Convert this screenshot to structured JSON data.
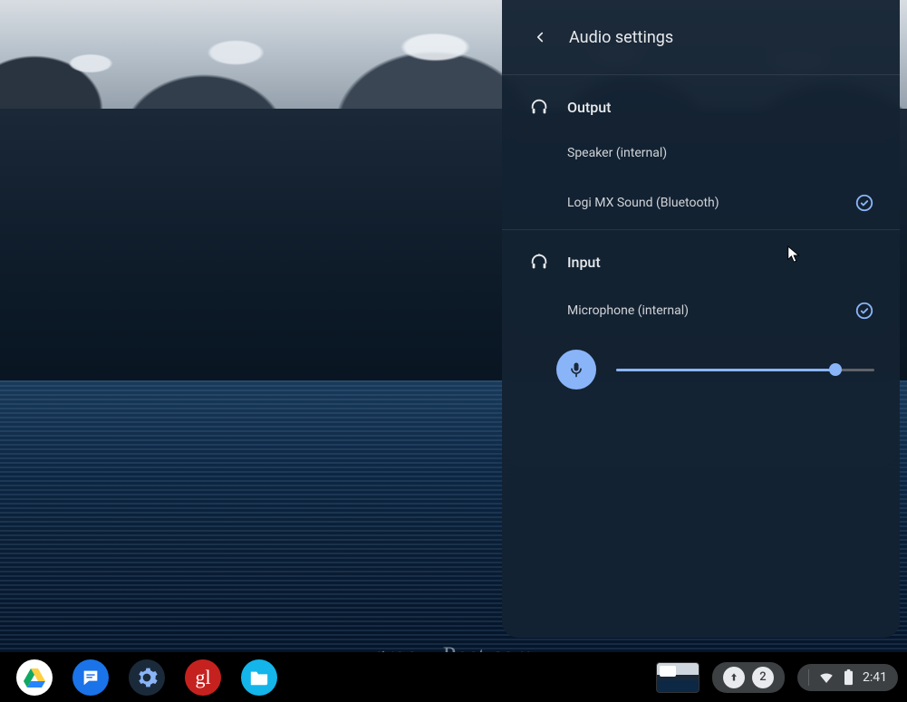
{
  "panel": {
    "title": "Audio settings",
    "output": {
      "heading": "Output",
      "devices": [
        {
          "label": "Speaker (internal)",
          "selected": false
        },
        {
          "label": "Logi MX Sound (Bluetooth)",
          "selected": true
        }
      ]
    },
    "input": {
      "heading": "Input",
      "devices": [
        {
          "label": "Microphone (internal)",
          "selected": true
        }
      ],
      "gain_percent": 85
    }
  },
  "shelf": {
    "apps": [
      {
        "name": "google-drive"
      },
      {
        "name": "messages"
      },
      {
        "name": "settings"
      },
      {
        "name": "gl-app"
      },
      {
        "name": "files"
      }
    ],
    "notifications": {
      "update_available": true,
      "count": 2
    },
    "tray": {
      "wifi": true,
      "battery_full": true,
      "time": "2:41"
    }
  },
  "watermark": "groovyPost.com",
  "colors": {
    "accent": "#8ab4f8",
    "panel_bg": "rgba(20,34,50,0.96)"
  }
}
